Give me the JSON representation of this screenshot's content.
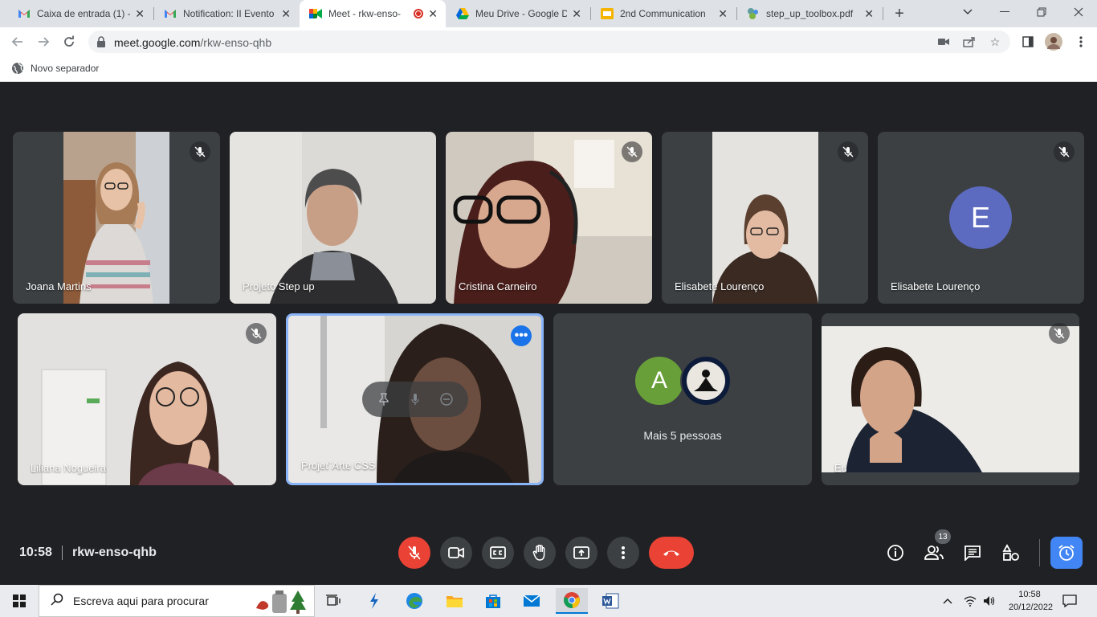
{
  "browser": {
    "tabs": [
      {
        "title": "Caixa de entrada (1) -",
        "icon": "gmail-icon"
      },
      {
        "title": "Notification: II Evento",
        "icon": "gmail-icon"
      },
      {
        "title": "Meet - rkw-enso-",
        "icon": "meet-icon",
        "active": true
      },
      {
        "title": "Meu Drive - Google D",
        "icon": "drive-icon"
      },
      {
        "title": "2nd Communication",
        "icon": "slides-icon"
      },
      {
        "title": "step_up_toolbox.pdf",
        "icon": "pdf-icon"
      }
    ],
    "url_host": "meet.google.com",
    "url_path": "/rkw-enso-qhb",
    "bookmark": "Novo separador"
  },
  "participants_row1": [
    {
      "name": "Joana Martins",
      "muted": true
    },
    {
      "name": "Projeto Step up",
      "muted": false
    },
    {
      "name": "Cristina Carneiro",
      "muted": true
    },
    {
      "name": "Elisabete Lourenço",
      "muted": true
    },
    {
      "name": "Elisabete Lourenço",
      "muted": true,
      "avatar_letter": "E"
    }
  ],
  "participants_row2": [
    {
      "name": "Liliana Nogueira",
      "muted": true
    },
    {
      "name": "Projet`Arte CSS",
      "speaking": true
    },
    {
      "name": "Mais 5 pessoas",
      "avatar_letter": "A"
    },
    {
      "name": "Eu",
      "muted": true
    }
  ],
  "meeting": {
    "time": "10:58",
    "code": "rkw-enso-qhb",
    "participant_count": "13"
  },
  "colors": {
    "end_call": "#ea4335",
    "accent": "#4285f4",
    "avatar_e": "#5c6bc0",
    "avatar_a": "#4caf50"
  },
  "taskbar": {
    "search_placeholder": "Escreva aqui para procurar",
    "time": "10:58",
    "date": "20/12/2022"
  }
}
